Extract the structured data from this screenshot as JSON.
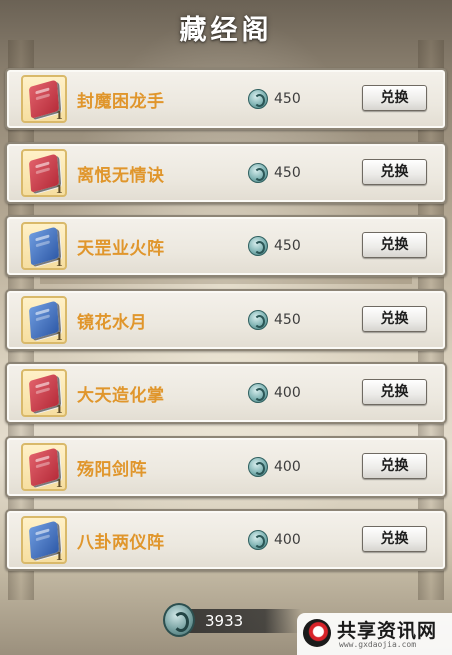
{
  "title": "藏经阁",
  "items": [
    {
      "name": "封魔困龙手",
      "price": "450",
      "qty": "1",
      "book_color": "red",
      "button": "兑换"
    },
    {
      "name": "离恨无情诀",
      "price": "450",
      "qty": "1",
      "book_color": "red",
      "button": "兑换"
    },
    {
      "name": "天罡业火阵",
      "price": "450",
      "qty": "1",
      "book_color": "blue",
      "button": "兑换"
    },
    {
      "name": "镜花水月",
      "price": "450",
      "qty": "1",
      "book_color": "blue",
      "button": "兑换"
    },
    {
      "name": "大天造化掌",
      "price": "400",
      "qty": "1",
      "book_color": "red",
      "button": "兑换"
    },
    {
      "name": "殇阳剑阵",
      "price": "400",
      "qty": "1",
      "book_color": "red",
      "button": "兑换"
    },
    {
      "name": "八卦两仪阵",
      "price": "400",
      "qty": "1",
      "book_color": "blue",
      "button": "兑换"
    }
  ],
  "balance": "3933",
  "currency_icon": "jade-coin-icon",
  "item_icon": "skill-book-icon",
  "colors": {
    "name_text": "#e0962c",
    "book_red": "#c23a46",
    "book_blue": "#3f6fc0"
  },
  "watermark": {
    "text": "共享资讯网",
    "url": "www.gxdaojia.com"
  }
}
